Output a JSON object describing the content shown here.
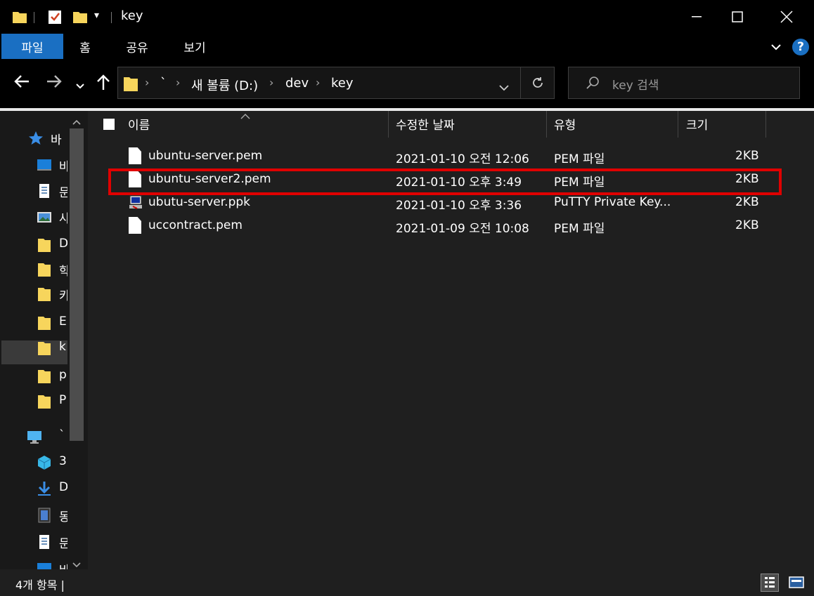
{
  "title": "key",
  "ribbon": {
    "tabs": [
      {
        "label": "파일"
      },
      {
        "label": "홈"
      },
      {
        "label": "공유"
      },
      {
        "label": "보기"
      }
    ]
  },
  "address": {
    "crumbs": [
      "`",
      "새 볼륨 (D:)",
      "dev",
      "key"
    ]
  },
  "search": {
    "placeholder": "key 검색"
  },
  "nav": {
    "items": [
      {
        "label": "바",
        "icon": "star-icon"
      },
      {
        "label": "바",
        "icon": "desktop-icon"
      },
      {
        "label": "문",
        "icon": "document-icon"
      },
      {
        "label": "사",
        "icon": "pictures-icon"
      },
      {
        "label": "D",
        "icon": "folder-icon"
      },
      {
        "label": "학",
        "icon": "folder-icon"
      },
      {
        "label": "카",
        "icon": "folder-icon"
      },
      {
        "label": "E",
        "icon": "folder-icon"
      },
      {
        "label": "k",
        "icon": "folder-icon"
      },
      {
        "label": "p",
        "icon": "folder-icon"
      },
      {
        "label": "P",
        "icon": "folder-icon"
      },
      {
        "label": "`",
        "icon": "computer-icon"
      },
      {
        "label": "3",
        "icon": "3d-objects-icon"
      },
      {
        "label": "D",
        "icon": "download-icon"
      },
      {
        "label": "동",
        "icon": "video-icon"
      },
      {
        "label": "문",
        "icon": "document-icon"
      },
      {
        "label": "바",
        "icon": "desktop-icon"
      }
    ]
  },
  "columns": {
    "name": "이름",
    "modified": "수정한 날짜",
    "type": "유형",
    "size": "크기"
  },
  "files": [
    {
      "name": "ubuntu-server.pem",
      "modified": "2021-01-10 오전 12:06",
      "type": "PEM 파일",
      "size": "2KB",
      "icon": "file-icon"
    },
    {
      "name": "ubuntu-server2.pem",
      "modified": "2021-01-10 오후 3:49",
      "type": "PEM 파일",
      "size": "2KB",
      "icon": "file-icon"
    },
    {
      "name": "ubutu-server.ppk",
      "modified": "2021-01-10 오후 3:36",
      "type": "PuTTY Private Key...",
      "size": "2KB",
      "icon": "putty-icon"
    },
    {
      "name": "uccontract.pem",
      "modified": "2021-01-09 오전 10:08",
      "type": "PEM 파일",
      "size": "2KB",
      "icon": "file-icon"
    }
  ],
  "status": {
    "text": "4개 항목  |"
  },
  "colors": {
    "accent": "#1a6fc2",
    "highlight": "#e00000",
    "folder": "#f7d55c"
  }
}
